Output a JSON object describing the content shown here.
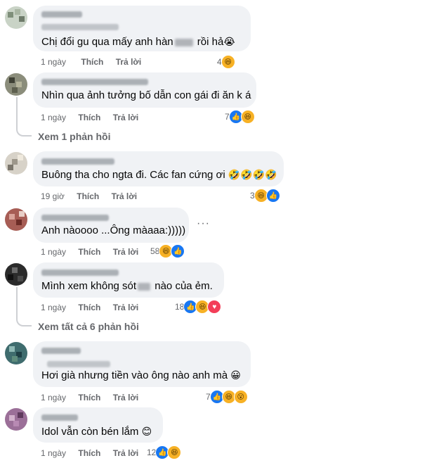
{
  "comments": [
    {
      "text": "Chị đổi gu qua mấy anh hàn",
      "text_after": " rồi hả",
      "emoji": "😭",
      "time": "1 ngày",
      "like": "Thích",
      "reply": "Trả lời",
      "count": "4",
      "reactions": [
        "haha"
      ]
    },
    {
      "text": "Nhìn qua ảnh tưởng bố dẫn con gái đi ăn k á",
      "time": "1 ngày",
      "like": "Thích",
      "reply": "Trả lời",
      "count": "7",
      "reactions": [
        "like",
        "haha"
      ],
      "replies_label": "Xem 1 phản hồi"
    },
    {
      "text": "Buông tha cho ngta đi. Các fan cứng ơi ",
      "emoji": "🤣🤣🤣🤣",
      "time": "19 giờ",
      "like": "Thích",
      "reply": "Trả lời",
      "count": "3",
      "reactions": [
        "haha",
        "like"
      ]
    },
    {
      "text": "Anh nàoooo ...Ông màaaa:)))))",
      "time": "1 ngày",
      "like": "Thích",
      "reply": "Trả lời",
      "count": "58",
      "reactions": [
        "haha",
        "like"
      ],
      "more": "···"
    },
    {
      "text": "Mình xem không sót",
      "text_after": " nào của ẻm.",
      "time": "1 ngày",
      "like": "Thích",
      "reply": "Trả lời",
      "count": "18",
      "reactions": [
        "like",
        "haha",
        "love"
      ],
      "replies_label": "Xem tất cả 6 phản hồi"
    },
    {
      "text": "Hơi già nhưng tiền vào ông nào anh mà ",
      "emoji": "😀",
      "time": "1 ngày",
      "like": "Thích",
      "reply": "Trả lời",
      "count": "7",
      "reactions": [
        "like",
        "haha",
        "wow"
      ]
    },
    {
      "text": "Idol vẫn còn bén lắm ",
      "emoji": "😊",
      "time": "1 ngày",
      "like": "Thích",
      "reply": "Trả lời",
      "count": "12",
      "reactions": [
        "like",
        "haha"
      ]
    }
  ],
  "icons": {
    "like": "like-icon",
    "haha": "haha-icon",
    "love": "love-icon",
    "wow": "wow-icon",
    "more": "more-options-icon"
  },
  "colors": {
    "bubble": "#f0f2f5",
    "meta": "#65676b",
    "like": "#1877f2",
    "haha": "#f7b125",
    "love": "#f33e58"
  }
}
